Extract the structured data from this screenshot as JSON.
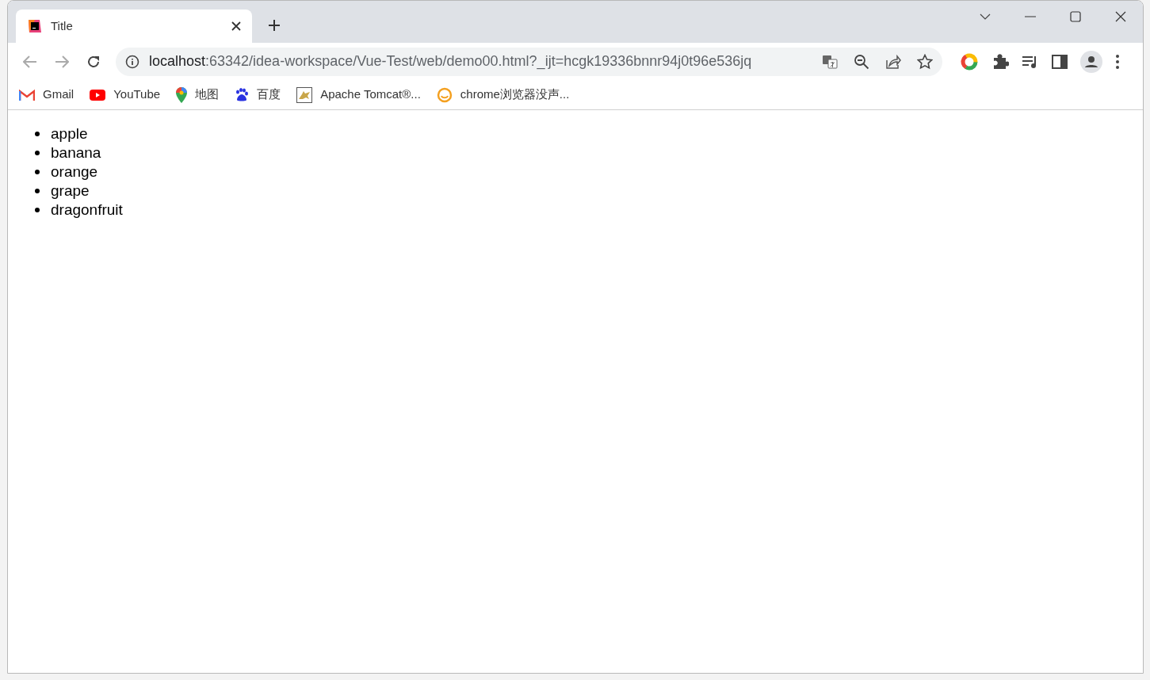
{
  "tabs": [
    {
      "title": "Title",
      "selected": true
    }
  ],
  "address_bar": {
    "host": "localhost",
    "path": ":63342/idea-workspace/Vue-Test/web/demo00.html?_ijt=hcgk19336bnnr94j0t96e536jq"
  },
  "bookmarks": [
    {
      "kind": "gmail",
      "label": "Gmail"
    },
    {
      "kind": "youtube",
      "label": "YouTube"
    },
    {
      "kind": "maps",
      "label": "地图"
    },
    {
      "kind": "baidu",
      "label": "百度"
    },
    {
      "kind": "tomcat",
      "label": "Apache Tomcat®..."
    },
    {
      "kind": "smile",
      "label": "chrome浏览器没声..."
    }
  ],
  "page": {
    "list_items": [
      "apple",
      "banana",
      "orange",
      "grape",
      "dragonfruit"
    ]
  }
}
